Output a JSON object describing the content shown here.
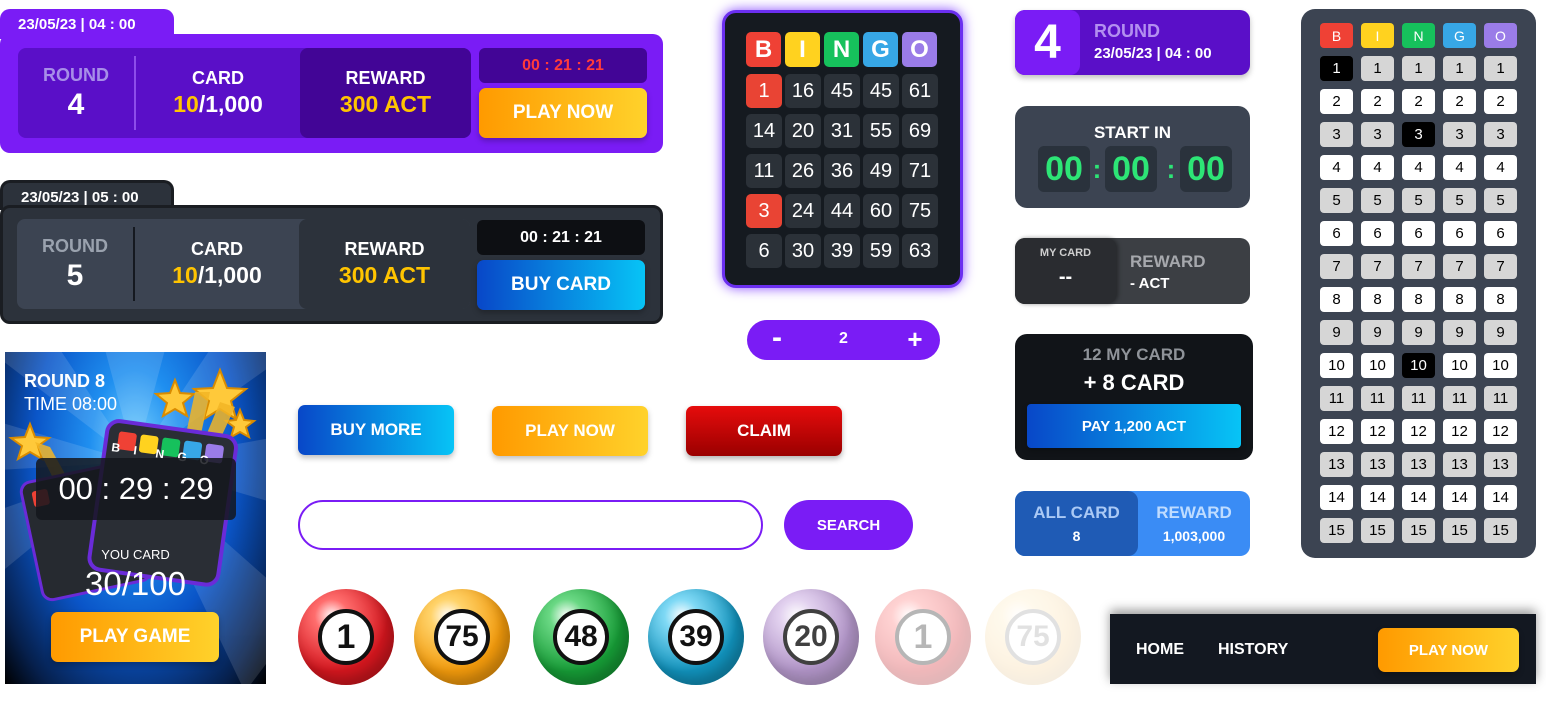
{
  "round_panel_1": {
    "datetime": "23/05/23 | 04 : 00",
    "round_label": "ROUND",
    "round_value": "4",
    "card_label": "CARD",
    "card_owned": "10",
    "card_total": "/1,000",
    "reward_label": "REWARD",
    "reward_value": "300 ACT",
    "timer": "00 : 21 : 21",
    "button": "PLAY NOW"
  },
  "round_panel_2": {
    "datetime": "23/05/23 | 05 : 00",
    "round_label": "ROUND",
    "round_value": "5",
    "card_label": "CARD",
    "card_owned": "10",
    "card_total": "/1,000",
    "reward_label": "REWARD",
    "reward_value": "300 ACT",
    "timer": "00 : 21 : 21",
    "button": "BUY CARD"
  },
  "bingo_card": {
    "header": [
      {
        "letter": "B",
        "color": "#ef4135"
      },
      {
        "letter": "I",
        "color": "#ffd21f"
      },
      {
        "letter": "N",
        "color": "#16c15c"
      },
      {
        "letter": "G",
        "color": "#37a7e6"
      },
      {
        "letter": "O",
        "color": "#9a7ce8"
      }
    ],
    "rows": [
      [
        "1",
        "16",
        "45",
        "45",
        "61"
      ],
      [
        "14",
        "20",
        "31",
        "55",
        "69"
      ],
      [
        "11",
        "26",
        "36",
        "49",
        "71"
      ],
      [
        "3",
        "24",
        "44",
        "60",
        "75"
      ],
      [
        "6",
        "30",
        "39",
        "59",
        "63"
      ]
    ],
    "marked": [
      "0-0",
      "3-0"
    ]
  },
  "stepper": {
    "minus": "-",
    "value": "2",
    "plus": "+"
  },
  "round_header": {
    "number": "4",
    "label": "ROUND",
    "datetime": "23/05/23 | 04 : 00"
  },
  "start_in": {
    "label": "START IN",
    "hours": "00",
    "minutes": "00",
    "seconds": "00",
    "sep": ":"
  },
  "my_card_widget": {
    "label": "MY CARD",
    "value": "--",
    "reward_label": "REWARD",
    "reward_value": "- ACT"
  },
  "pay_widget": {
    "my_card": "12 MY CARD",
    "add_card": "+ 8 CARD",
    "button": "PAY 1,200 ACT"
  },
  "all_card_widget": {
    "all_label": "ALL CARD",
    "all_value": "8",
    "reward_label": "REWARD",
    "reward_value": "1,003,000"
  },
  "number_grid": {
    "header": [
      {
        "letter": "B",
        "color": "#ef4135"
      },
      {
        "letter": "I",
        "color": "#ffd21f"
      },
      {
        "letter": "N",
        "color": "#16c15c"
      },
      {
        "letter": "G",
        "color": "#37a7e6"
      },
      {
        "letter": "O",
        "color": "#9a7ce8"
      }
    ],
    "rows": [
      "1",
      "2",
      "3",
      "4",
      "5",
      "6",
      "7",
      "8",
      "9",
      "10",
      "11",
      "12",
      "13",
      "14",
      "15"
    ],
    "selected": [
      "0-0",
      "2-2",
      "9-2"
    ]
  },
  "promo_card": {
    "round": "ROUND 8",
    "time": "TIME 08:00",
    "countdown": "00 : 29 : 29",
    "you_card_label": "YOU CARD",
    "you_card_value": "30/100",
    "button": "PLAY GAME",
    "mini_letters": [
      "B",
      "I",
      "N",
      "G",
      "O"
    ]
  },
  "buttons": {
    "buy_more": "BUY MORE",
    "play_now": "PLAY NOW",
    "claim": "CLAIM"
  },
  "search": {
    "placeholder": "",
    "button": "SEARCH"
  },
  "balls": [
    {
      "number": "1",
      "color": "#d4161e",
      "light": "#ff6d6d",
      "opacity": 1
    },
    {
      "number": "75",
      "color": "#f29a0c",
      "light": "#ffd36a",
      "opacity": 1
    },
    {
      "number": "48",
      "color": "#169b36",
      "light": "#6ad884",
      "opacity": 1
    },
    {
      "number": "39",
      "color": "#1192bc",
      "light": "#7fd9f5",
      "opacity": 1
    },
    {
      "number": "20",
      "color": "#9c78b8",
      "light": "#dcc7ec",
      "opacity": 0.8
    },
    {
      "number": "1",
      "color": "#d4161e",
      "light": "#ff6d6d",
      "opacity": 0.3
    },
    {
      "number": "75",
      "color": "#f29a0c",
      "light": "#ffd36a",
      "opacity": 0.12
    }
  ],
  "nav": {
    "home": "HOME",
    "history": "HISTORY",
    "button": "PLAY NOW"
  }
}
